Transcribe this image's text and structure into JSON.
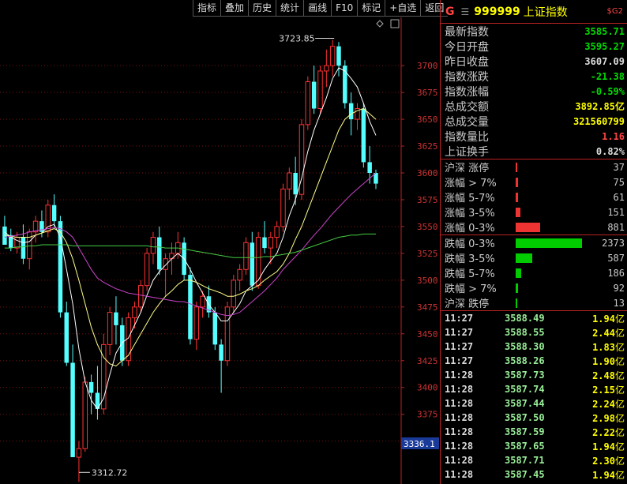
{
  "toolbar": [
    "指标",
    "叠加",
    "历史",
    "统计",
    "画线",
    "F10",
    "标记",
    "+自选",
    "返回"
  ],
  "chart_data": {
    "type": "candlestick",
    "y_ticks": [
      3350,
      3375,
      3400,
      3425,
      3450,
      3475,
      3500,
      3525,
      3550,
      3575,
      3600,
      3625,
      3650,
      3675,
      3700
    ],
    "ylim": [
      3310,
      3745
    ],
    "max_label": "3723.85",
    "min_label": "3312.72",
    "current_price_label": "3336.1",
    "candles": [
      [
        3550,
        3560,
        3542,
        3533
      ],
      [
        3542,
        3548,
        3527,
        3530
      ],
      [
        3530,
        3545,
        3525,
        3540
      ],
      [
        3540,
        3552,
        3515,
        3520
      ],
      [
        3520,
        3548,
        3510,
        3545
      ],
      [
        3545,
        3560,
        3535,
        3555
      ],
      [
        3555,
        3565,
        3540,
        3545
      ],
      [
        3545,
        3575,
        3540,
        3570
      ],
      [
        3570,
        3580,
        3550,
        3555
      ],
      [
        3555,
        3560,
        3465,
        3470
      ],
      [
        3470,
        3480,
        3420,
        3423
      ],
      [
        3423,
        3440,
        3335,
        3335
      ],
      [
        3335,
        3350,
        3312,
        3343
      ],
      [
        3343,
        3410,
        3340,
        3405
      ],
      [
        3405,
        3412,
        3375,
        3395
      ],
      [
        3395,
        3420,
        3370,
        3380
      ],
      [
        3380,
        3450,
        3375,
        3440
      ],
      [
        3440,
        3475,
        3430,
        3470
      ],
      [
        3470,
        3485,
        3440,
        3458
      ],
      [
        3458,
        3465,
        3420,
        3425
      ],
      [
        3425,
        3470,
        3420,
        3465
      ],
      [
        3465,
        3480,
        3455,
        3475
      ],
      [
        3475,
        3500,
        3470,
        3495
      ],
      [
        3495,
        3530,
        3490,
        3525
      ],
      [
        3525,
        3545,
        3515,
        3540
      ],
      [
        3540,
        3550,
        3505,
        3510
      ],
      [
        3510,
        3525,
        3485,
        3520
      ],
      [
        3520,
        3535,
        3505,
        3525
      ],
      [
        3525,
        3545,
        3520,
        3535
      ],
      [
        3535,
        3540,
        3500,
        3505
      ],
      [
        3505,
        3512,
        3440,
        3445
      ],
      [
        3445,
        3480,
        3435,
        3475
      ],
      [
        3475,
        3490,
        3465,
        3485
      ],
      [
        3485,
        3495,
        3465,
        3470
      ],
      [
        3470,
        3475,
        3435,
        3440
      ],
      [
        3440,
        3445,
        3395,
        3425
      ],
      [
        3425,
        3480,
        3420,
        3475
      ],
      [
        3475,
        3505,
        3470,
        3500
      ],
      [
        3500,
        3515,
        3490,
        3510
      ],
      [
        3510,
        3540,
        3505,
        3535
      ],
      [
        3535,
        3545,
        3490,
        3495
      ],
      [
        3495,
        3545,
        3492,
        3540
      ],
      [
        3540,
        3555,
        3525,
        3530
      ],
      [
        3530,
        3545,
        3515,
        3540
      ],
      [
        3540,
        3555,
        3530,
        3550
      ],
      [
        3550,
        3590,
        3545,
        3585
      ],
      [
        3585,
        3605,
        3575,
        3600
      ],
      [
        3600,
        3615,
        3570,
        3580
      ],
      [
        3580,
        3650,
        3575,
        3645
      ],
      [
        3645,
        3690,
        3640,
        3685
      ],
      [
        3685,
        3700,
        3655,
        3660
      ],
      [
        3660,
        3700,
        3655,
        3695
      ],
      [
        3695,
        3715,
        3680,
        3700
      ],
      [
        3700,
        3724,
        3690,
        3718
      ],
      [
        3718,
        3722,
        3690,
        3700
      ],
      [
        3700,
        3705,
        3660,
        3665
      ],
      [
        3665,
        3675,
        3635,
        3650
      ],
      [
        3650,
        3665,
        3640,
        3660
      ],
      [
        3660,
        3665,
        3605,
        3610
      ],
      [
        3610,
        3625,
        3590,
        3600
      ],
      [
        3600,
        3603,
        3585,
        3590
      ]
    ],
    "ma_lines": [
      {
        "color": "#ffffff",
        "values": [
          3545,
          3540,
          3537,
          3535,
          3536,
          3542,
          3544,
          3550,
          3552,
          3540,
          3510,
          3478,
          3436,
          3405,
          3388,
          3380,
          3390,
          3412,
          3432,
          3442,
          3446,
          3458,
          3470,
          3486,
          3500,
          3508,
          3514,
          3520,
          3525,
          3520,
          3510,
          3498,
          3488,
          3477,
          3470,
          3462,
          3462,
          3470,
          3478,
          3490,
          3495,
          3500,
          3510,
          3518,
          3525,
          3540,
          3560,
          3575,
          3595,
          3620,
          3640,
          3655,
          3670,
          3688,
          3698,
          3695,
          3688,
          3680,
          3665,
          3648,
          3635
        ]
      },
      {
        "color": "#ffff88",
        "values": [
          3542,
          3541,
          3540,
          3540,
          3540,
          3542,
          3544,
          3546,
          3548,
          3545,
          3535,
          3520,
          3500,
          3478,
          3456,
          3440,
          3428,
          3422,
          3420,
          3425,
          3430,
          3440,
          3450,
          3460,
          3470,
          3478,
          3485,
          3490,
          3496,
          3500,
          3500,
          3498,
          3495,
          3492,
          3490,
          3488,
          3485,
          3485,
          3487,
          3490,
          3492,
          3495,
          3500,
          3504,
          3508,
          3515,
          3525,
          3538,
          3550,
          3565,
          3580,
          3595,
          3610,
          3625,
          3640,
          3650,
          3655,
          3658,
          3660,
          3655,
          3650
        ]
      },
      {
        "color": "#cc44cc",
        "values": [
          3540,
          3541,
          3542,
          3543,
          3545,
          3546,
          3547,
          3548,
          3549,
          3548,
          3545,
          3540,
          3530,
          3520,
          3510,
          3502,
          3498,
          3495,
          3492,
          3490,
          3488,
          3487,
          3486,
          3485,
          3484,
          3483,
          3482,
          3481,
          3480,
          3480,
          3478,
          3476,
          3474,
          3472,
          3470,
          3468,
          3467,
          3468,
          3470,
          3475,
          3480,
          3485,
          3490,
          3496,
          3502,
          3510,
          3516,
          3522,
          3528,
          3535,
          3542,
          3548,
          3555,
          3562,
          3568,
          3574,
          3580,
          3585,
          3590,
          3595,
          3600
        ]
      },
      {
        "color": "#44cc44",
        "values": [
          3530,
          3530,
          3531,
          3531,
          3532,
          3532,
          3533,
          3533,
          3533,
          3533,
          3533,
          3532,
          3532,
          3532,
          3532,
          3532,
          3532,
          3532,
          3532,
          3532,
          3532,
          3532,
          3532,
          3532,
          3531,
          3531,
          3530,
          3530,
          3530,
          3529,
          3528,
          3527,
          3526,
          3525,
          3524,
          3523,
          3522,
          3521,
          3521,
          3521,
          3521,
          3521,
          3522,
          3522,
          3523,
          3524,
          3525,
          3526,
          3528,
          3530,
          3532,
          3534,
          3536,
          3538,
          3540,
          3541,
          3542,
          3542,
          3543,
          3543,
          3543
        ]
      }
    ]
  },
  "header": {
    "mark": "G",
    "menu": "☰",
    "code": "999999",
    "name": "上证指数",
    "sub": "$G2"
  },
  "stats": [
    {
      "label": "最新指数",
      "value": "3585.71",
      "color": "green"
    },
    {
      "label": "今日开盘",
      "value": "3595.27",
      "color": "green"
    },
    {
      "label": "昨日收盘",
      "value": "3607.09",
      "color": "white"
    },
    {
      "label": "指数涨跌",
      "value": "-21.38",
      "color": "green"
    },
    {
      "label": "指数涨幅",
      "value": "-0.59%",
      "color": "green"
    },
    {
      "label": "总成交额",
      "value": "3892.85亿",
      "color": "yellow"
    },
    {
      "label": "总成交量",
      "value": "321560799",
      "color": "yellow"
    },
    {
      "label": "指数量比",
      "value": "1.16",
      "color": "red"
    },
    {
      "label": "上证换手",
      "value": "0.82%",
      "color": "white"
    }
  ],
  "breadth_up": [
    {
      "label": "沪深 涨停",
      "count": "37",
      "fraction": 0.02,
      "color": "#ee3333"
    },
    {
      "label": "涨幅 > 7%",
      "count": "75",
      "fraction": 0.03,
      "color": "#ee3333"
    },
    {
      "label": "涨幅 5-7%",
      "count": "61",
      "fraction": 0.03,
      "color": "#ee3333"
    },
    {
      "label": "涨幅 3-5%",
      "count": "151",
      "fraction": 0.07,
      "color": "#ee3333"
    },
    {
      "label": "涨幅 0-3%",
      "count": "881",
      "fraction": 0.37,
      "color": "#ee3333"
    }
  ],
  "breadth_down": [
    {
      "label": "跌幅 0-3%",
      "count": "2373",
      "fraction": 1.0,
      "color": "#00cc00"
    },
    {
      "label": "跌幅 3-5%",
      "count": "587",
      "fraction": 0.25,
      "color": "#00cc00"
    },
    {
      "label": "跌幅 5-7%",
      "count": "186",
      "fraction": 0.08,
      "color": "#00cc00"
    },
    {
      "label": "跌幅 > 7%",
      "count": "92",
      "fraction": 0.04,
      "color": "#00cc00"
    },
    {
      "label": "沪深 跌停",
      "count": "13",
      "fraction": 0.01,
      "color": "#00cc00"
    }
  ],
  "ticks": [
    {
      "time": "11:27",
      "price": "3588.49",
      "vol": "1.94",
      "unit": "亿"
    },
    {
      "time": "11:27",
      "price": "3588.55",
      "vol": "2.44",
      "unit": "亿"
    },
    {
      "time": "11:27",
      "price": "3588.30",
      "vol": "1.83",
      "unit": "亿"
    },
    {
      "time": "11:27",
      "price": "3588.26",
      "vol": "1.90",
      "unit": "亿"
    },
    {
      "time": "11:28",
      "price": "3587.73",
      "vol": "2.48",
      "unit": "亿"
    },
    {
      "time": "11:28",
      "price": "3587.74",
      "vol": "2.15",
      "unit": "亿"
    },
    {
      "time": "11:28",
      "price": "3587.44",
      "vol": "2.24",
      "unit": "亿"
    },
    {
      "time": "11:28",
      "price": "3587.50",
      "vol": "2.98",
      "unit": "亿"
    },
    {
      "time": "11:28",
      "price": "3587.59",
      "vol": "2.22",
      "unit": "亿"
    },
    {
      "time": "11:28",
      "price": "3587.65",
      "vol": "1.94",
      "unit": "亿"
    },
    {
      "time": "11:28",
      "price": "3587.71",
      "vol": "2.30",
      "unit": "亿"
    },
    {
      "time": "11:28",
      "price": "3587.45",
      "vol": "1.94",
      "unit": "亿"
    }
  ]
}
